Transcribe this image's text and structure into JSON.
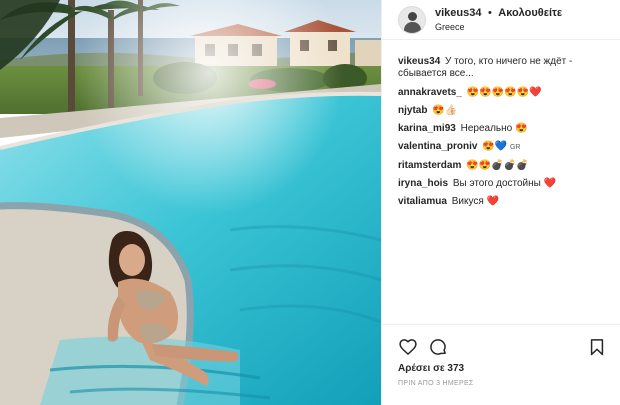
{
  "post": {
    "username": "vikeus34",
    "separator": "•",
    "follow_label": "Ακολουθείτε",
    "location": "Greece"
  },
  "caption": {
    "user": "vikeus34",
    "text": "У того, кто ничего не ждёт - сбывается все..."
  },
  "comments": [
    {
      "user": "annakravets_",
      "text": "",
      "emoji": "😍😍😍😍😍❤️"
    },
    {
      "user": "njytab",
      "text": "",
      "emoji": "😍👍🏻"
    },
    {
      "user": "karina_mi93",
      "text": "Нереально",
      "emoji": "😍"
    },
    {
      "user": "valentina_proniv",
      "text": "",
      "emoji": "😍💙",
      "suffix": "GR"
    },
    {
      "user": "ritamsterdam",
      "text": "",
      "emoji": "😍😍💣💣💣"
    },
    {
      "user": "iryna_hois",
      "text": "Вы этого достойны",
      "emoji": "❤️"
    },
    {
      "user": "vitaliamua",
      "text": "Викуся",
      "emoji": "❤️"
    }
  ],
  "footer": {
    "likes_text": "Αρέσει σε 373",
    "time_text": "ΠΡΙΝ ΑΠΟ 3 ΗΜΕΡΕΣ"
  },
  "icons": {
    "like": "heart-icon",
    "comment": "comment-bubble-icon",
    "save": "bookmark-icon"
  },
  "colors": {
    "text": "#262626",
    "muted": "#999999",
    "border": "#efefef",
    "heart_red": "#ed4956"
  }
}
